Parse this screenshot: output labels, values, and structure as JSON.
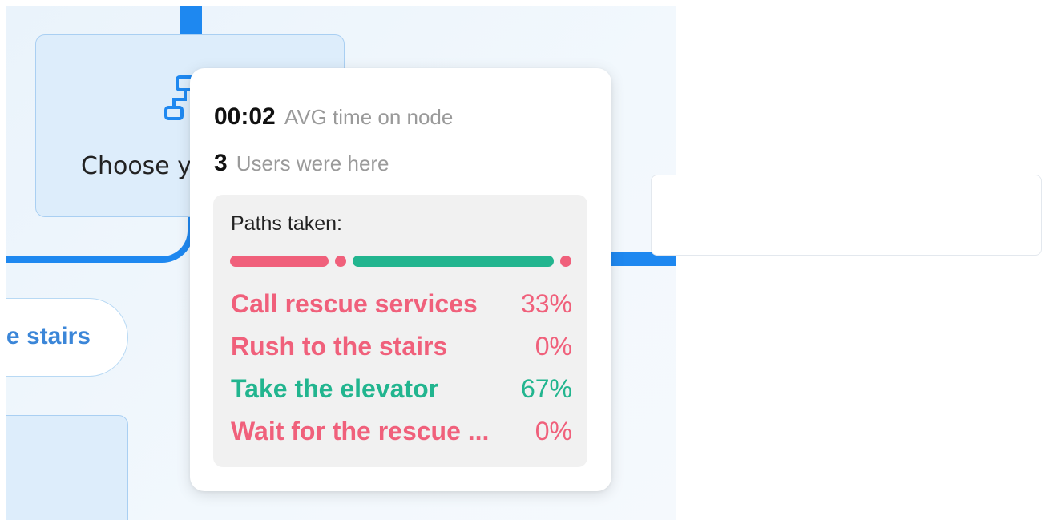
{
  "canvas": {
    "node_choose": {
      "label": "Choose y",
      "icon": "flow-node-icon"
    },
    "pill_stairs": {
      "label": "e stairs"
    }
  },
  "tooltip": {
    "avg_time": {
      "value": "00:02",
      "label": "AVG time on node"
    },
    "users": {
      "value": "3",
      "label": "Users were here"
    },
    "paths_title": "Paths taken:",
    "paths": [
      {
        "name": "Call rescue services",
        "percent": "33%",
        "share": 0.33,
        "color": "#f0607b"
      },
      {
        "name": "Rush to the stairs",
        "percent": "0%",
        "share": 0.0,
        "color": "#f0607b"
      },
      {
        "name": "Take the elevator",
        "percent": "67%",
        "share": 0.67,
        "color": "#22b58f"
      },
      {
        "name": "Wait for the rescue ...",
        "percent": "0%",
        "share": 0.0,
        "color": "#f0607b"
      }
    ]
  },
  "colors": {
    "connector": "#1e88f0",
    "negative": "#f0607b",
    "positive": "#22b58f"
  }
}
